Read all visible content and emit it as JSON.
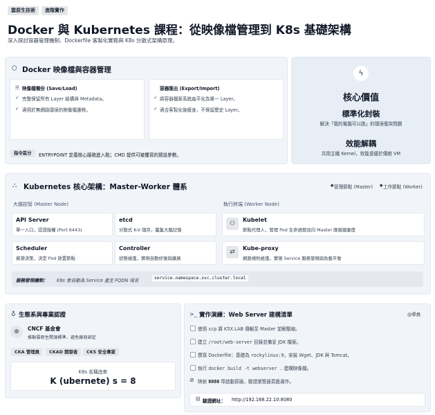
{
  "tags": [
    "雲原生技術",
    "進階實作"
  ],
  "title": "Docker 與 Kubernetes 課程：從映像檔管理到 K8s 基礎架構",
  "subtitle": "深入探討容器管理機制、Dockerfile 客製化實務與 K8s 分散式架構原理。",
  "docker": {
    "heading": "Docker 映像檔與容器管理",
    "backup": {
      "title": "映像檔備份 (Save/Load)",
      "items": [
        "完整保留所有 Layer 結構與 Metadata。",
        "適用於無網路環境的映像檔遷移。"
      ]
    },
    "export": {
      "title": "容器匯出 (Export/Import)",
      "items": [
        "將容器檔案系統扁平化為單一 Layer。",
        "適合客製化後瘦身，不保留歷史 Layer。"
      ]
    },
    "note_label": "指令區分",
    "note_text": "ENTRYPOINT 定義核心服務進入點；CMD 提供可被覆寫的預設參數。"
  },
  "core": {
    "heading": "核心價值",
    "v1_title": "標準化封裝",
    "v1_desc": "解決「我的電腦可以跑」的環境衝突問題",
    "v2_title": "效能解耦",
    "v2_desc": "共用主機 Kernel，效能遠優於傳統 VM"
  },
  "k8s": {
    "heading": "Kubernetes 核心架構：Master-Worker 體系",
    "legend_master": "管理節點 (Master)",
    "legend_worker": "工作節點 (Worker)",
    "master_label": "大腦控管 (Master Node)",
    "worker_label": "執行終端 (Worker Node)",
    "api_name": "API Server",
    "api_desc": "單一入口，認證授權 (Port 6443)",
    "etcd_name": "etcd",
    "etcd_desc": "分散式 K-V 儲存，叢集大腦記憶",
    "sched_name": "Scheduler",
    "sched_desc": "資源決策，決定 Pod 放置節點",
    "ctrl_name": "Controller",
    "ctrl_desc": "狀態維護，實現自動修復與擴展",
    "kubelet_name": "Kubelet",
    "kubelet_desc": "節點代理人，管理 Pod 生命週期並向 Master 匯報健康度",
    "proxy_name": "Kube-proxy",
    "proxy_desc": "網路規則維護，實現 Service 服務發現與負載平衡",
    "discovery_label": "服務發現機制：",
    "discovery_text": "K8s 會自動為 Service 產生 FQDN 域名",
    "discovery_code": "service.namespace.svc.cluster.local"
  },
  "eco": {
    "heading": "生態系與專業認證",
    "cncf_title": "CNCF 基金會",
    "cncf_desc": "推動雲原生開源標準，避免廠商綁定",
    "chips": [
      "CKA 管理員",
      "CKAD 開發者",
      "CKS 安全專家"
    ],
    "name_caption": "K8s 名稱由來",
    "name_formula": "K (ubernete) s = 8"
  },
  "lab": {
    "heading": "實作演練：Web Server 建構清單",
    "badge": "@學員",
    "steps": [
      {
        "pre": "使用 ",
        "code": "scp",
        "post": " 將 K5X.LAB 傳輸至 Master 並解壓縮。"
      },
      {
        "pre": "建立 ",
        "code": "/root/web-server",
        "post": " 目錄並備妥 JDK 檔案。"
      },
      {
        "pre": "撰寫 Dockerfile：基礎為 ",
        "code": "rockylinux:9",
        "post": "，安裝 Wget、JDK 與 Tomcat。"
      },
      {
        "pre": "執行 ",
        "code": "docker build -t webserver .",
        "post": " 建構映像檔。"
      },
      {
        "pre": "映射 ",
        "code": "8080",
        "post": " 埠啟動容器，驗證瀏覽器頁面運作。"
      }
    ],
    "url_label": "驗證網址：",
    "url": "http://192.168.22.10:8080"
  }
}
